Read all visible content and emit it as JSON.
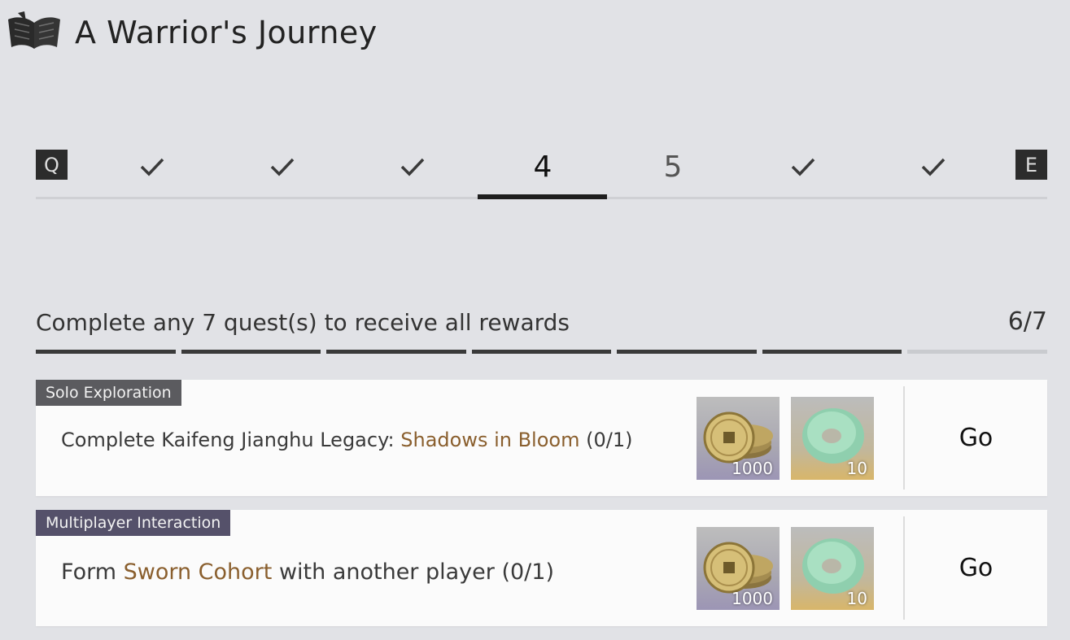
{
  "header": {
    "title": "A Warrior's Journey",
    "icon": "open-book-icon"
  },
  "tabs": {
    "prev_key": "Q",
    "next_key": "E",
    "items": [
      {
        "label": "",
        "state": "completed",
        "icon": "checkmark-icon"
      },
      {
        "label": "",
        "state": "completed",
        "icon": "checkmark-icon"
      },
      {
        "label": "",
        "state": "completed",
        "icon": "checkmark-icon"
      },
      {
        "label": "4",
        "state": "active"
      },
      {
        "label": "5",
        "state": "incomplete"
      },
      {
        "label": "",
        "state": "completed",
        "icon": "checkmark-icon"
      },
      {
        "label": "",
        "state": "completed",
        "icon": "checkmark-icon"
      }
    ]
  },
  "progress": {
    "title": "Complete any 7 quest(s) to receive all rewards",
    "count": "6/7",
    "completed": 6,
    "total": 7
  },
  "quests": [
    {
      "category": "Solo Exploration",
      "desc_before": "Complete Kaifeng Jianghu Legacy: ",
      "desc_highlight": "Shadows in Bloom",
      "desc_after": " (0/1)",
      "rewards": [
        {
          "icon": "coin-stack-icon",
          "qty": "1000"
        },
        {
          "icon": "jade-ring-icon",
          "qty": "10"
        }
      ],
      "action": "Go"
    },
    {
      "category": "Multiplayer Interaction",
      "desc_before": "Form ",
      "desc_highlight": "Sworn Cohort",
      "desc_after": " with another player (0/1)",
      "rewards": [
        {
          "icon": "coin-stack-icon",
          "qty": "1000"
        },
        {
          "icon": "jade-ring-icon",
          "qty": "10"
        }
      ],
      "action": "Go"
    }
  ],
  "colors": {
    "background": "#e1e2e6",
    "highlight": "#8a5f2e",
    "dark": "#2c2c2c",
    "solo_badge": "#5b5b5f",
    "multi_badge": "#55516a"
  }
}
